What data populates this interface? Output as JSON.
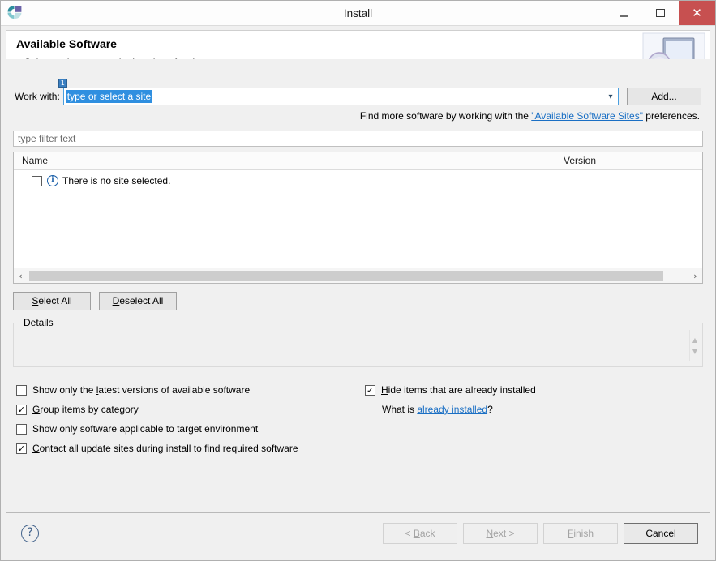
{
  "window": {
    "title": "Install",
    "app_icon": "eclipse-icon",
    "controls": {
      "minimize": "minimize-icon",
      "maximize": "maximize-icon",
      "close": "close-icon",
      "close_color": "#c75050"
    }
  },
  "header": {
    "title": "Available Software",
    "description": "Select a site or enter the location of a site.",
    "graphic": "monitor-disc-icon"
  },
  "work_with": {
    "label_prefix": "W",
    "label_rest": "ork with:",
    "badge": "1",
    "value": "type or select a site",
    "dropdown_icon": "chevron-down-icon",
    "add_button": {
      "mnemonic": "A",
      "rest": "dd..."
    }
  },
  "find_more": {
    "prefix": "Find more software by working with the ",
    "link": "\"Available Software Sites\"",
    "suffix": " preferences."
  },
  "filter": {
    "placeholder": "type filter text",
    "value": ""
  },
  "table": {
    "columns": [
      "Name",
      "Version"
    ],
    "rows": [
      {
        "checked": false,
        "icon": "info-icon",
        "icon_glyph": "i",
        "name": "There is no site selected.",
        "version": ""
      }
    ],
    "hscroll": {
      "left_arrow": "‹",
      "right_arrow": "›"
    }
  },
  "selection_buttons": {
    "select_all": {
      "mnemonic": "S",
      "rest": "elect All"
    },
    "deselect_all": {
      "mnemonic": "D",
      "rest": "eselect All"
    }
  },
  "details": {
    "legend": "Details",
    "content": "",
    "scroll_up": "▲",
    "scroll_down": "▼"
  },
  "options": {
    "left": [
      {
        "checked": false,
        "pre": "Show only the ",
        "mnemonic": "l",
        "post": "atest versions of available software"
      },
      {
        "checked": true,
        "pre": "",
        "mnemonic": "G",
        "post": "roup items by category"
      },
      {
        "checked": false,
        "pre": "Show only software applicable to target environment",
        "mnemonic": "",
        "post": ""
      },
      {
        "checked": true,
        "pre": "",
        "mnemonic": "C",
        "post": "ontact all update sites during install to find required software"
      }
    ],
    "right": {
      "checkbox": {
        "checked": true,
        "pre": "",
        "mnemonic": "H",
        "post": "ide items that are already installed"
      },
      "what_is": {
        "prefix": "What is ",
        "link": "already installed",
        "suffix": "?"
      }
    }
  },
  "footer": {
    "help": "?",
    "buttons": [
      {
        "label": "< Back",
        "mnemonic": "B",
        "pre": "< ",
        "post": "ack",
        "enabled": false
      },
      {
        "label": "Next >",
        "mnemonic": "N",
        "pre": "",
        "post": "ext >",
        "enabled": false
      },
      {
        "label": "Finish",
        "mnemonic": "F",
        "pre": "",
        "post": "inish",
        "enabled": false
      },
      {
        "label": "Cancel",
        "mnemonic": "",
        "pre": "Cancel",
        "post": "",
        "enabled": true,
        "is_default": true
      }
    ]
  }
}
